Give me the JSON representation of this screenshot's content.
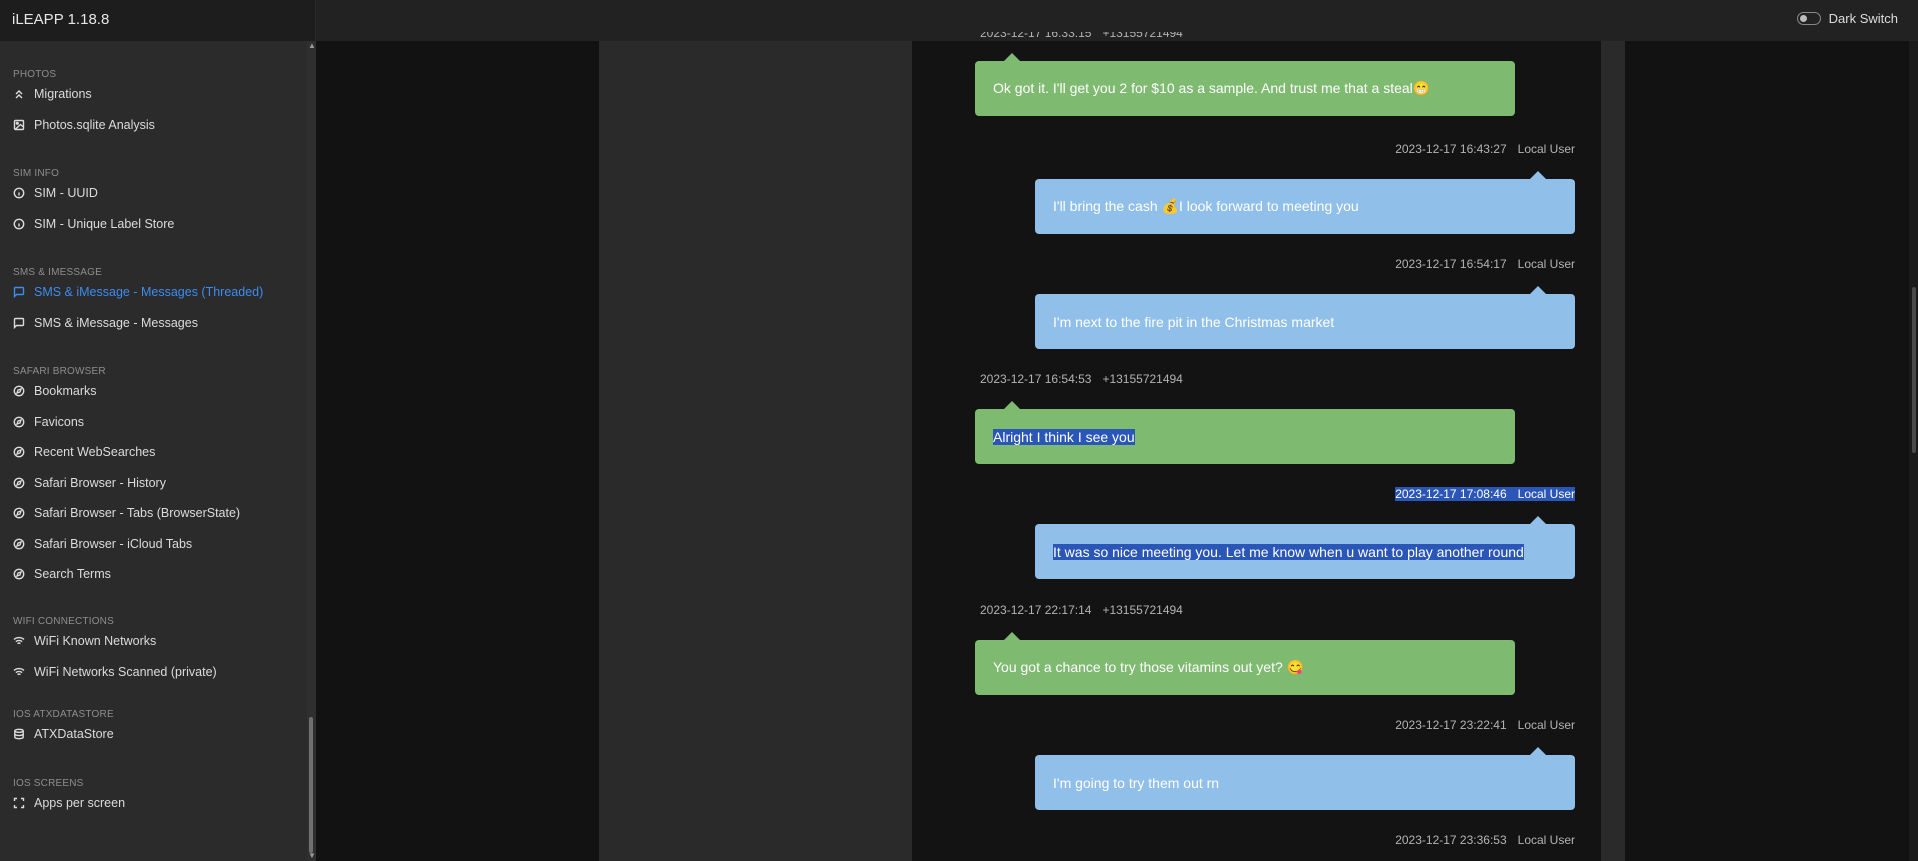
{
  "app": {
    "title": "iLEAPP 1.18.8",
    "dark_switch_label": "Dark Switch"
  },
  "sidebar": {
    "sections": [
      {
        "title": "PHOTOS",
        "items": [
          {
            "label": "Migrations",
            "icon": "chevrons-up-icon"
          },
          {
            "label": "Photos.sqlite Analysis",
            "icon": "image-icon"
          }
        ]
      },
      {
        "title": "SIM INFO",
        "items": [
          {
            "label": "SIM - UUID",
            "icon": "info-icon"
          },
          {
            "label": "SIM - Unique Label Store",
            "icon": "info-icon"
          }
        ]
      },
      {
        "title": "SMS & IMESSAGE",
        "items": [
          {
            "label": "SMS & iMessage - Messages (Threaded)",
            "icon": "message-square-icon",
            "active": true
          },
          {
            "label": "SMS & iMessage - Messages",
            "icon": "message-square-icon"
          }
        ]
      },
      {
        "title": "SAFARI BROWSER",
        "items": [
          {
            "label": "Bookmarks",
            "icon": "compass-icon"
          },
          {
            "label": "Favicons",
            "icon": "compass-icon"
          },
          {
            "label": "Recent WebSearches",
            "icon": "compass-icon"
          },
          {
            "label": "Safari Browser - History",
            "icon": "compass-icon"
          },
          {
            "label": "Safari Browser - Tabs (BrowserState)",
            "icon": "compass-icon"
          },
          {
            "label": "Safari Browser - iCloud Tabs",
            "icon": "compass-icon"
          },
          {
            "label": "Search Terms",
            "icon": "compass-icon"
          }
        ]
      },
      {
        "title": "WIFI CONNECTIONS",
        "items": [
          {
            "label": "WiFi Known Networks",
            "icon": "wifi-icon"
          },
          {
            "label": "WiFi Networks Scanned (private)",
            "icon": "wifi-icon"
          }
        ]
      },
      {
        "title": "IOS ATXDATASTORE",
        "items": [
          {
            "label": "ATXDataStore",
            "icon": "database-icon"
          }
        ]
      },
      {
        "title": "IOS SCREENS",
        "items": [
          {
            "label": "Apps per screen",
            "icon": "maximize-icon"
          }
        ]
      }
    ]
  },
  "messages": [
    {
      "side": "received",
      "time": "2023-12-17 16:33:15",
      "sender": "+13155721494",
      "text": "Ok got it. I'll get you 2 for $10 as a sample. And trust me that a steal😁",
      "meta_clipped": true
    },
    {
      "side": "sent",
      "time": "2023-12-17 16:43:27",
      "sender": "Local User",
      "text": "I'll bring the cash 💰I look forward to meeting you"
    },
    {
      "side": "sent",
      "time": "2023-12-17 16:54:17",
      "sender": "Local User",
      "text": "I'm next to the fire pit in the Christmas market"
    },
    {
      "side": "received",
      "time": "2023-12-17 16:54:53",
      "sender": "+13155721494",
      "text": "Alright I think I see you",
      "text_selected": true
    },
    {
      "side": "sent",
      "time": "2023-12-17 17:08:46",
      "sender": "Local User",
      "text": "It was so nice meeting you. Let me know when u want to play another round",
      "meta_selected": true,
      "text_selected": true
    },
    {
      "side": "received",
      "time": "2023-12-17 22:17:14",
      "sender": "+13155721494",
      "text": "You got a chance to try those vitamins out yet? 😋"
    },
    {
      "side": "sent",
      "time": "2023-12-17 23:22:41",
      "sender": "Local User",
      "text": "I'm going to try them out rn"
    },
    {
      "side": "sent",
      "time": "2023-12-17 23:36:53",
      "sender": "Local User",
      "text": ""
    }
  ],
  "colors": {
    "received_bubble": "#7fba71",
    "sent_bubble": "#90bfe9",
    "active_link": "#3d8cf0",
    "selection": "#2a56b8"
  }
}
